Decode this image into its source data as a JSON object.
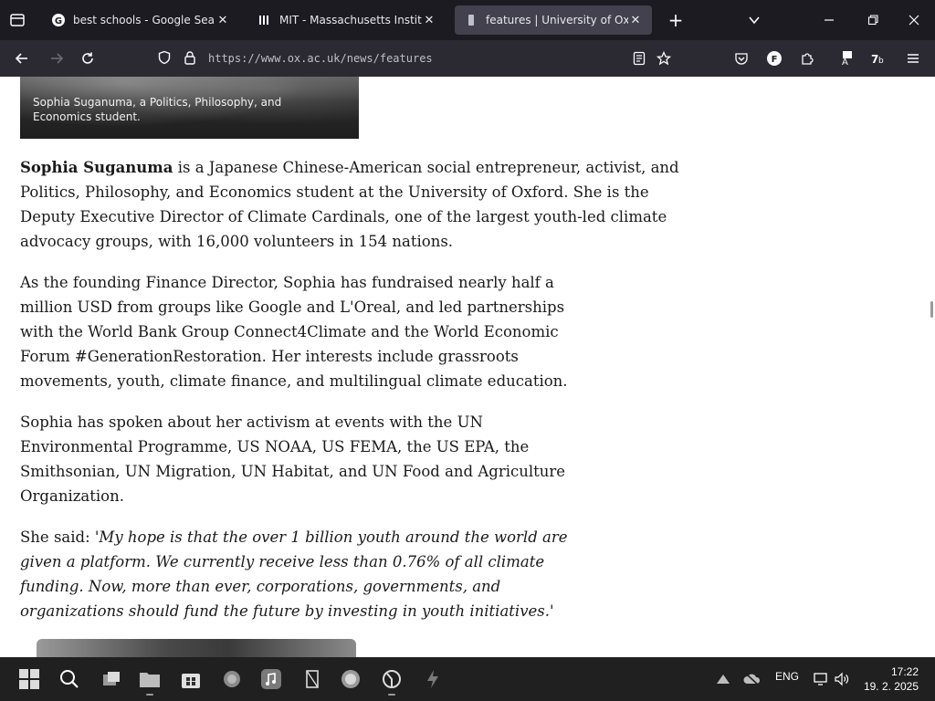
{
  "browser": {
    "tabs": [
      {
        "title": "best schools - Google Search",
        "favicon": "google-icon",
        "active": false
      },
      {
        "title": "MIT - Massachusetts Institute of Technology",
        "favicon": "mit-icon",
        "active": false
      },
      {
        "title": "features | University of Oxford",
        "favicon": "oxford-icon",
        "active": true
      }
    ],
    "close_glyph": "✕",
    "new_tab_glyph": "+",
    "url": "https://www.ox.ac.uk/news/features"
  },
  "page": {
    "hero_caption": "Sophia Suganuma, a Politics, Philosophy, and Economics student.",
    "p1_name": "Sophia Suganuma",
    "p1_rest": " is a Japanese Chinese-American social entrepreneur, activist, and Politics, Philosophy, and Economics student at the University of Oxford. She is the Deputy Executive Director of Climate Cardinals, one of the largest youth-led climate advocacy groups, with 16,000 volunteers in 154 nations.",
    "p2": "As the founding Finance Director, Sophia has fundraised nearly half a million USD from groups like Google and L'Oreal, and led partnerships with the World Bank Group Connect4Climate and the World Economic Forum #GenerationRestoration. Her interests include grassroots movements, youth, climate finance, and multilingual climate education.",
    "p3": "Sophia has spoken about her activism at events with the UN Environmental Programme, US NOAA, US FEMA, the US EPA, the Smithsonian, UN Migration, UN Habitat, and UN Food and Agriculture Organization.",
    "p4_lead": "She said: ",
    "p4_quote": "'My hope is that the over 1 billion youth around the world are given a platform. We currently receive less than 0.76% of all climate funding. Now, more than ever, corporations, governments, and organizations should fund the future by investing in youth initiatives.'"
  },
  "taskbar": {
    "language": "ENG",
    "time": "17:22",
    "date": "19. 2. 2025"
  }
}
